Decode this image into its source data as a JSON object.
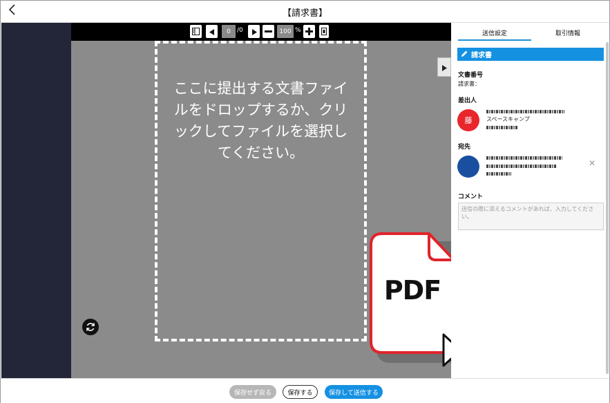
{
  "window": {
    "title": "【請求書】"
  },
  "toolbar": {
    "page_current": "0",
    "page_total": "/0",
    "zoom": "100",
    "zoom_unit": "%"
  },
  "viewer": {
    "drop_text": "ここに提出する文書ファイルをドロップするか、クリックしてファイルを選択してください。",
    "pdf_label": "PDF"
  },
  "panel": {
    "tabs": [
      {
        "label": "送信設定",
        "active": true
      },
      {
        "label": "取引情報",
        "active": false
      }
    ],
    "section_title": "請求書",
    "doc_number_label": "文書番号",
    "doc_number_value": "請求書：",
    "sender_label": "差出人",
    "sender": {
      "avatar_text": "藤",
      "avatar_color": "#e8262b",
      "company": "スペースキャンプ"
    },
    "recipient_label": "宛先",
    "recipient": {
      "avatar_color": "#1a4fa0"
    },
    "comment_label": "コメント",
    "comment_placeholder": "送信の際に添えるコメントがあれば、入力してください。"
  },
  "actions": {
    "discard_label": "保存せず戻る",
    "save_label": "保存する",
    "save_send_label": "保存して送信する"
  },
  "colors": {
    "accent": "#1591e2",
    "sidebar_dark": "#222638",
    "viewer_bg": "#8b8b8b",
    "pdf_red": "#e0242c"
  }
}
